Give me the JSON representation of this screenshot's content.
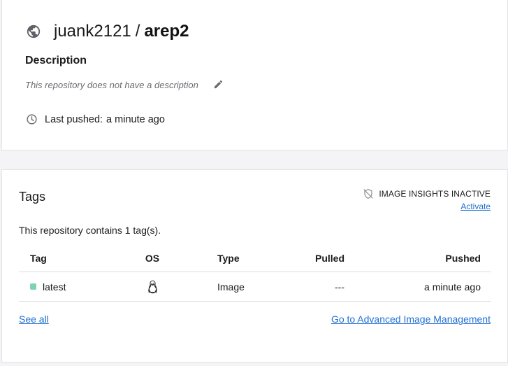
{
  "repository": {
    "namespace": "juank2121",
    "separator": "/",
    "name": "arep2",
    "icon": "globe-icon",
    "description_heading": "Description",
    "description_text": "This repository does not have a description",
    "last_pushed_label": "Last pushed:",
    "last_pushed_value": "a minute ago"
  },
  "tags_panel": {
    "title": "Tags",
    "insights_status": "IMAGE INSIGHTS INACTIVE",
    "activate_label": "Activate",
    "count_text": "This repository contains 1 tag(s).",
    "columns": {
      "tag": "Tag",
      "os": "OS",
      "type": "Type",
      "pulled": "Pulled",
      "pushed": "Pushed"
    },
    "rows": [
      {
        "tag": "latest",
        "os_icon": "linux-icon",
        "type": "Image",
        "pulled": "---",
        "pushed": "a minute ago",
        "status_color": "#7fd3b0"
      }
    ],
    "see_all_label": "See all",
    "advanced_label": "Go to Advanced Image Management"
  },
  "colors": {
    "link": "#1f6fd1",
    "muted_text": "#6b6b72",
    "tag_status": "#7fd3b0"
  }
}
